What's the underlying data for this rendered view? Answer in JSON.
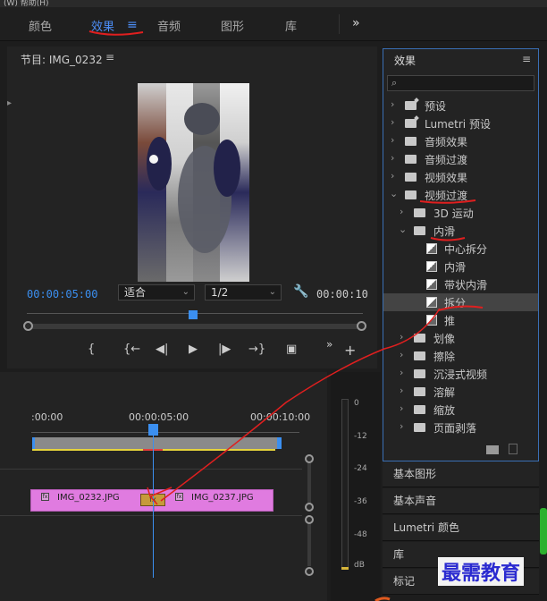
{
  "menubar": {
    "partial_text": "(W)   帮助(H)"
  },
  "workspace_tabs": [
    {
      "label": "颜色",
      "active": false
    },
    {
      "label": "效果",
      "active": true
    },
    {
      "label": "音频",
      "active": false
    },
    {
      "label": "图形",
      "active": false
    },
    {
      "label": "库",
      "active": false
    }
  ],
  "workspace": {
    "menu_icon": "≡",
    "more_icon": "»"
  },
  "program_monitor": {
    "title": "节目: IMG_0232",
    "menu_icon": "≡",
    "timecode_current": "00:00:05:00",
    "fit_select": "适合",
    "resolution_select": "1/2",
    "timecode_duration": "00:00:10"
  },
  "transport": {
    "mark_in": "{",
    "go_to_in": "{←",
    "step_back": "◀|",
    "play": "▶",
    "step_forward": "|▶",
    "go_to_out": "→}",
    "export_frame": "▣",
    "more": "»",
    "add": "+"
  },
  "timeline": {
    "ruler_labels": [
      ":00:00",
      "00:00:05:00",
      "00:00:10:00"
    ],
    "clips": [
      {
        "name": "IMG_0232.JPG",
        "fx": "fx"
      },
      {
        "name": "IMG_0237.JPG",
        "fx": "fx"
      }
    ],
    "transition_label": "fx"
  },
  "audio_meter": {
    "labels": [
      "0",
      "-12",
      "-24",
      "-36",
      "-48",
      "dB"
    ]
  },
  "effects_panel": {
    "title": "效果",
    "menu_icon": "≡",
    "search_placeholder": "",
    "items": [
      {
        "label": "预设",
        "icon": "folder-star-icon",
        "level": 0,
        "expanded": false
      },
      {
        "label": "Lumetri 预设",
        "icon": "folder-star-icon",
        "level": 0,
        "expanded": false
      },
      {
        "label": "音频效果",
        "icon": "folder-icon",
        "level": 0,
        "expanded": false
      },
      {
        "label": "音频过渡",
        "icon": "folder-icon",
        "level": 0,
        "expanded": false
      },
      {
        "label": "视频效果",
        "icon": "folder-icon",
        "level": 0,
        "expanded": false
      },
      {
        "label": "视频过渡",
        "icon": "folder-icon",
        "level": 0,
        "expanded": true
      },
      {
        "label": "3D 运动",
        "icon": "folder-icon",
        "level": 1,
        "expanded": false
      },
      {
        "label": "内滑",
        "icon": "folder-icon",
        "level": 1,
        "expanded": true
      },
      {
        "label": "中心拆分",
        "icon": "transition-icon",
        "level": 2
      },
      {
        "label": "内滑",
        "icon": "transition-icon",
        "level": 2
      },
      {
        "label": "带状内滑",
        "icon": "transition-icon",
        "level": 2
      },
      {
        "label": "拆分",
        "icon": "transition-icon",
        "level": 2,
        "selected": true
      },
      {
        "label": "推",
        "icon": "transition-icon",
        "level": 2
      },
      {
        "label": "划像",
        "icon": "folder-icon",
        "level": 1,
        "expanded": false
      },
      {
        "label": "擦除",
        "icon": "folder-icon",
        "level": 1,
        "expanded": false
      },
      {
        "label": "沉浸式视频",
        "icon": "folder-icon",
        "level": 1,
        "expanded": false
      },
      {
        "label": "溶解",
        "icon": "folder-icon",
        "level": 1,
        "expanded": false
      },
      {
        "label": "缩放",
        "icon": "folder-icon",
        "level": 1,
        "expanded": false
      },
      {
        "label": "页面剥落",
        "icon": "folder-icon",
        "level": 1,
        "expanded": false
      }
    ]
  },
  "panel_tabs": [
    "基本图形",
    "基本声音",
    "Lumetri 颜色",
    "库",
    "标记"
  ],
  "watermark": "最需教育",
  "colors": {
    "accent": "#3b8ff0",
    "clip": "#e07be0",
    "annotation": "#e01f1f"
  }
}
